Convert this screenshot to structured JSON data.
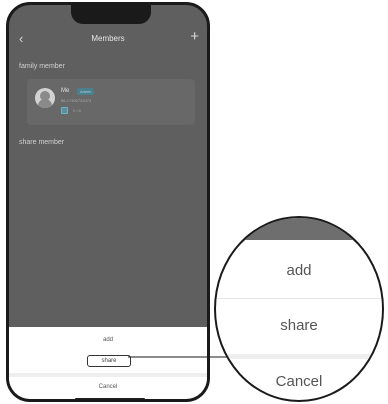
{
  "header": {
    "title": "Members"
  },
  "sections": {
    "family": "family member",
    "share": "share member"
  },
  "member": {
    "name": "Me",
    "badge": "Admin",
    "id": "86-17492733473",
    "device_count": "0 / 8"
  },
  "sheet": {
    "add": "add",
    "share": "share",
    "cancel": "Cancel"
  },
  "zoom": {
    "add": "add",
    "share": "share",
    "cancel": "Cancel"
  }
}
